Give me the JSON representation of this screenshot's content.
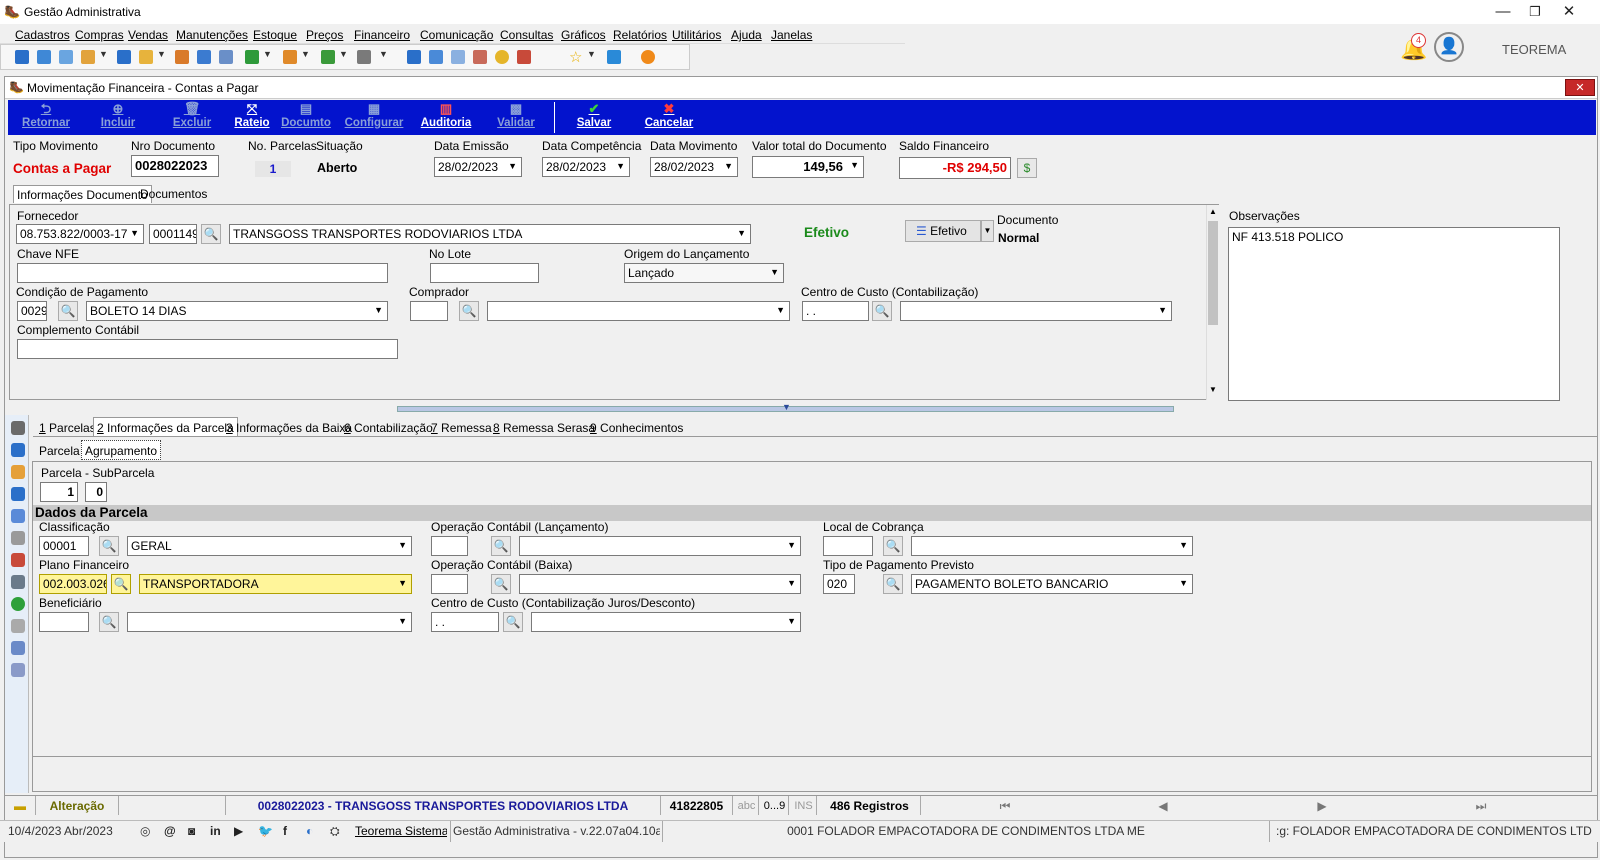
{
  "window": {
    "title": "Gestão Administrativa"
  },
  "menu": [
    "Cadastros",
    "Compras",
    "Vendas",
    "Manutenções",
    "Estoque",
    "Preços",
    "Financeiro",
    "Comunicação",
    "Consultas",
    "Gráficos",
    "Relatórios",
    "Utilitários",
    "Ajuda",
    "Janelas"
  ],
  "user": {
    "notifications": "4",
    "name": "TEOREMA"
  },
  "form": {
    "title": "Movimentação Financeira - Contas a Pagar",
    "actions": [
      "Retornar",
      "Incluir",
      "Excluir",
      "Rateio",
      "Documto",
      "Configurar",
      "Auditoria",
      "Validar",
      "Salvar",
      "Cancelar"
    ],
    "header": {
      "tipo_label": "Tipo Movimento",
      "tipo": "Contas a Pagar",
      "nro_label": "Nro Documento",
      "nro": "0028022023",
      "parcelas_label": "No. Parcelas",
      "parcelas": "1",
      "situacao_label": "Situação",
      "situacao": "Aberto",
      "emissao_label": "Data Emissão",
      "emissao": "28/02/2023",
      "competencia_label": "Data Competência",
      "competencia": "28/02/2023",
      "movimento_label": "Data Movimento",
      "movimento": "28/02/2023",
      "valor_label": "Valor total do Documento",
      "valor": "149,56",
      "saldo_label": "Saldo Financeiro",
      "saldo": "-R$ 294,50"
    },
    "doc_tabs": [
      "Informações Documento",
      "Documentos"
    ],
    "doc": {
      "fornecedor_label": "Fornecedor",
      "fornecedor_cnpj": "08.753.822/0003-17",
      "fornecedor_cod": "0001149",
      "fornecedor_nome": "TRANSGOSS TRANSPORTES RODOVIARIOS LTDA",
      "efetivo_text": "Efetivo",
      "efetivo_btn": "Efetivo",
      "documento_label": "Documento",
      "documento": "Normal",
      "chave_label": "Chave NFE",
      "lote_label": "No Lote",
      "origem_label": "Origem do Lançamento",
      "origem": "Lançado",
      "condicao_label": "Condição de Pagamento",
      "condicao_cod": "0029",
      "condicao": "BOLETO 14 DIAS",
      "comprador_label": "Comprador",
      "centro_label": "Centro de Custo (Contabilização)",
      "centro_cod": " .  . ",
      "complemento_label": "Complemento Contábil",
      "obs_label": "Observações",
      "obs": "NF 413.518 POLICO"
    },
    "parcel_tabs": [
      {
        "key": "1",
        "rest": " Parcelas"
      },
      {
        "key": "2",
        "rest": " Informações da Parcela"
      },
      {
        "key": "3",
        "rest": " Informações da Baixa"
      },
      {
        "key": "6",
        "rest": " Contabilização"
      },
      {
        "key": "7",
        "rest": " Remessa"
      },
      {
        "key": "8",
        "rest": " Remessa Serasa"
      },
      {
        "key": "9",
        "rest": " Conhecimentos"
      }
    ],
    "sub_tabs": [
      "Parcela",
      "Agrupamento"
    ],
    "parcela": {
      "label": "Parcela - SubParcela",
      "num": "1",
      "sub": "0",
      "section": "Dados da Parcela",
      "classificacao_label": "Classificação",
      "classificacao_cod": "00001",
      "classificacao": "GERAL",
      "plano_label": "Plano Financeiro",
      "plano_cod": "002.003.026",
      "plano": "TRANSPORTADORA",
      "beneficiario_label": "Beneficiário",
      "op_lanc_label": "Operação Contábil (Lançamento)",
      "op_baixa_label": "Operação Contábil (Baixa)",
      "cc_juros_label": "Centro de Custo (Contabilização Juros/Desconto)",
      "cc_juros_cod": " .  . ",
      "local_label": "Local de Cobrança",
      "tipo_pag_label": "Tipo de Pagamento Previsto",
      "tipo_pag_cod": "020",
      "tipo_pag": "PAGAMENTO BOLETO BANCARIO"
    }
  },
  "status1": {
    "mode": "Alteração",
    "doc": "0028022023 - TRANSGOSS TRANSPORTES RODOVIARIOS LTDA",
    "id": "41822805",
    "abc": "abc",
    "range": "0...9",
    "ins": "INS",
    "registros": "486 Registros"
  },
  "status2": {
    "date": "10/4/2023 Abr/2023",
    "company_link": "Teorema Sistemas",
    "version": "Gestão Administrativa - v.22.07a04.10a",
    "empresa": "0001 FOLADOR EMPACOTADORA DE CONDIMENTOS LTDA ME",
    "empresa2": ":g: FOLADOR EMPACOTADORA DE CONDIMENTOS LTD"
  },
  "colors": {
    "blue_bar": "#0313cd",
    "red": "#e00000",
    "green": "#1a8a1a",
    "highlight": "#fff59a"
  }
}
